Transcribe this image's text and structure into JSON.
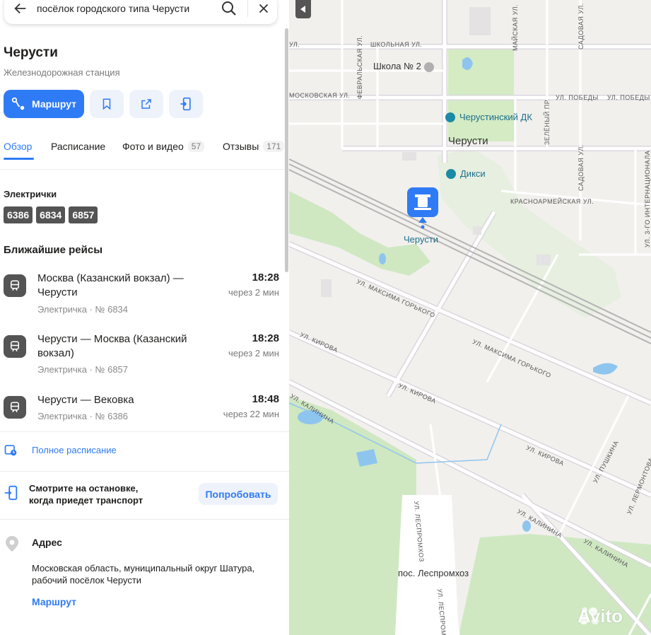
{
  "search": {
    "query": "посёлок городского типа Черусти"
  },
  "place": {
    "title": "Черусти",
    "subtitle": "Железнодорожная станция"
  },
  "actions": {
    "route_label": "Маршрут"
  },
  "tabs": [
    {
      "label": "Обзор"
    },
    {
      "label": "Расписание"
    },
    {
      "label": "Фото и видео",
      "count": "57"
    },
    {
      "label": "Отзывы",
      "count": "171"
    }
  ],
  "trains": {
    "heading": "Электрички",
    "numbers": [
      "6386",
      "6834",
      "6857"
    ]
  },
  "nearest": {
    "heading": "Ближайшие рейсы",
    "trips": [
      {
        "name": "Москва (Казанский вокзал) — Черусти",
        "meta": "Электричка · № 6834",
        "time": "18:28",
        "in": "через 2 мин"
      },
      {
        "name": "Черусти — Москва (Казанский вокзал)",
        "meta": "Электричка · № 6857",
        "time": "18:28",
        "in": "через 2 мин"
      },
      {
        "name": "Черусти — Вековка",
        "meta": "Электричка · № 6386",
        "time": "18:48",
        "in": "через 22 мин"
      }
    ]
  },
  "full_schedule": "Полное расписание",
  "promo": {
    "line1": "Смотрите на остановке,",
    "line2": "когда приедет транспорт",
    "button": "Попробовать"
  },
  "address": {
    "heading": "Адрес",
    "line1": "Московская область, муниципальный округ Шатура,",
    "line2": "рабочий посёлок Черусти",
    "route": "Маршрут"
  },
  "map": {
    "labels": {
      "school": "Школа № 2",
      "dk": "Черустинский ДК",
      "town": "Черусти",
      "dixi": "Дикси",
      "station": "Черусти",
      "lespromhoz": "пос. Леспромхоз"
    },
    "streets": {
      "shkolnaya": "ШКОЛЬНАЯ УЛ.",
      "ul_short": "УЛ.",
      "moskovskaya": "МОСКОВСКАЯ УЛ.",
      "fevralskaya": "ФЕВРАЛЬСКАЯ УЛ.",
      "pobedy1": "УЛ. ПОБЕДЫ",
      "pobedy2": "УЛ. ПОБЕДЫ",
      "mayskaya": "МАЙСКАЯ УЛ.",
      "sadovaya1": "САДОВАЯ УЛ.",
      "sadovaya2": "САДОВАЯ УЛ.",
      "zeleny": "ЗЕЛЁНЫЙ ПР.",
      "krasnoarm": "КРАСНОАРМЕЙСКАЯ УЛ.",
      "internac": "УЛ. 3-ГО ИНТЕРНАЦИОНАЛА",
      "gorkogo1": "УЛ. МАКСИМА ГОРЬКОГО",
      "gorkogo2": "УЛ. МАКСИМА ГОРЬКОГО",
      "kirova1": "УЛ. КИРОВА",
      "kirova2": "УЛ. КИРОВА",
      "kirova3": "УЛ. КИРОВА",
      "kalinina1": "УЛ. КАЛИНИНА",
      "kalinina2": "УЛ. КАЛИНИНА",
      "kalinina3": "УЛ. КАЛИНИНА",
      "pushkina": "УЛ. ПУШКИНА",
      "lermontova": "УЛ. ЛЕРМОНТОВА",
      "lespromhoz1": "УЛ. ЛЕСПРОМХОЗ",
      "lespromhoz2": "УЛ. ЛЕСПРОМХОЗ"
    },
    "watermark": "Avito"
  },
  "colors": {
    "accent": "#2f7bf5",
    "chip": "#545454",
    "map_bg": "#f2f0ed",
    "park": "#cfe8c2",
    "water": "#8ec5ef"
  }
}
